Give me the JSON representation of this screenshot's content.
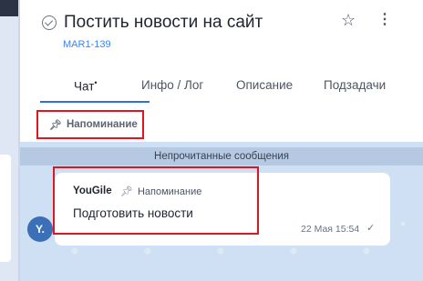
{
  "task": {
    "title": "Постить новости на сайт",
    "id": "MAR1-139"
  },
  "tabs": [
    {
      "label": "Чат",
      "marker": "•",
      "active": true
    },
    {
      "label": "Инфо / Лог",
      "active": false
    },
    {
      "label": "Описание",
      "active": false
    },
    {
      "label": "Подзадачи",
      "active": false
    }
  ],
  "reminder_chip": {
    "label": "Напоминание",
    "icon": "pin-icon"
  },
  "chat": {
    "unread_label": "Непрочитанные сообщения",
    "message": {
      "avatar": "Y.",
      "author": "YouGile",
      "tag": "Напоминание",
      "text": "Подготовить новости",
      "time": "22 Мая 15:54"
    }
  },
  "colors": {
    "accent": "#2f6fe0",
    "task_id": "#3b82f6",
    "highlight": "#e0161f",
    "chat_bg": "#cfe0f4"
  }
}
